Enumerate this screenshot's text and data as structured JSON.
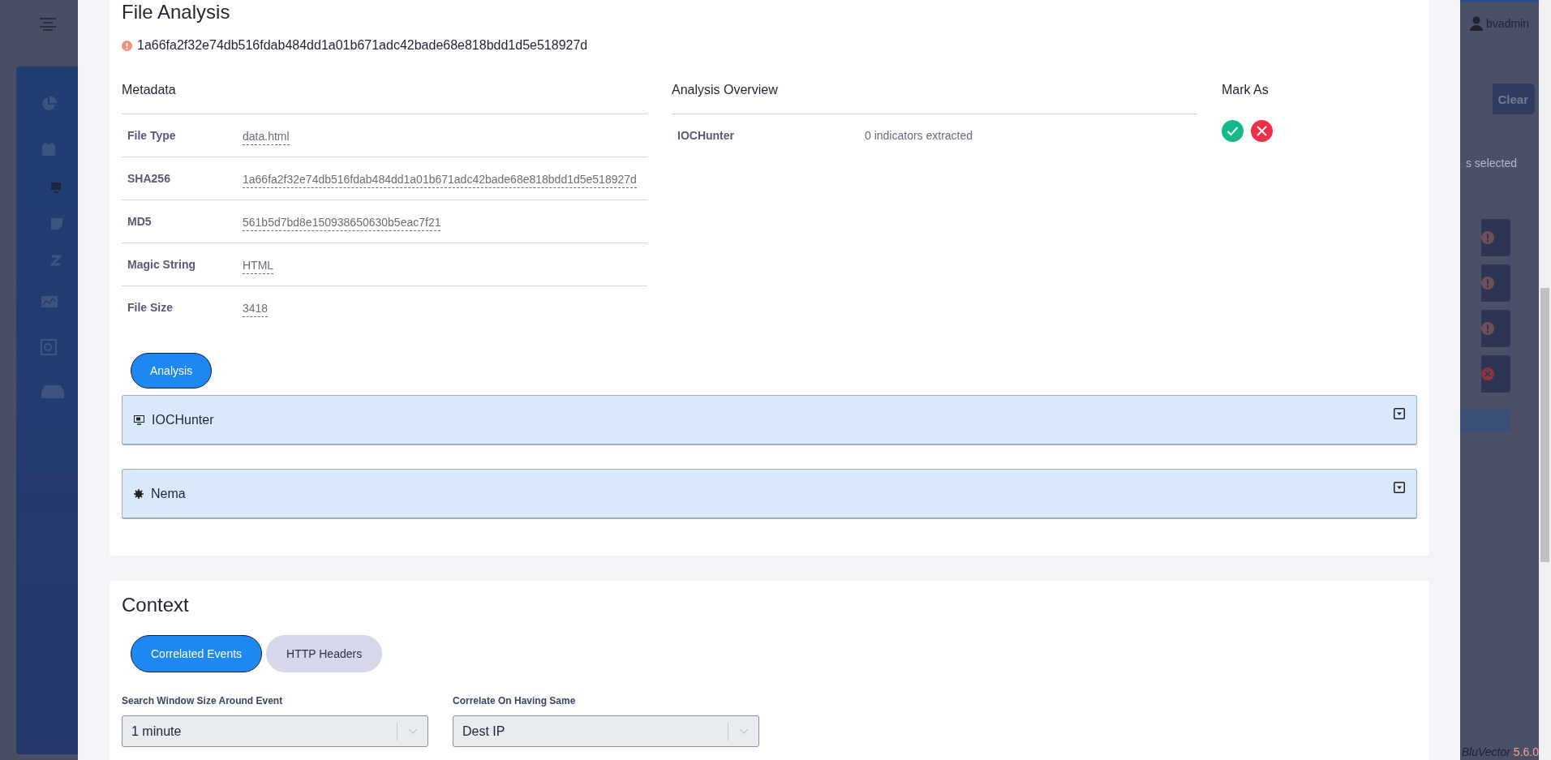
{
  "background": {
    "user": "bvadmin",
    "clear_button": "Clear",
    "selection_text": "s selected",
    "alerts": [
      {
        "kind": "warning"
      },
      {
        "kind": "warning"
      },
      {
        "kind": "warning"
      },
      {
        "kind": "error"
      }
    ],
    "footer": {
      "brand": "BluVector",
      "version": "5.6.0"
    }
  },
  "file_analysis": {
    "title": "File Analysis",
    "hash": "1a66fa2f32e74db516fdab484dd1a01b671adc42bade68e818bdd1d5e518927d",
    "metadata": {
      "heading": "Metadata",
      "rows": [
        {
          "label": "File Type",
          "value": "data.html"
        },
        {
          "label": "SHA256",
          "value": "1a66fa2f32e74db516fdab484dd1a01b671adc42bade68e818bdd1d5e518927d"
        },
        {
          "label": "MD5",
          "value": "561b5d7bd8e150938650630b5eac7f21"
        },
        {
          "label": "Magic String",
          "value": "HTML"
        },
        {
          "label": "File Size",
          "value": "3418"
        }
      ]
    },
    "overview": {
      "heading": "Analysis Overview",
      "rows": [
        {
          "label": "IOCHunter",
          "value": "0 indicators extracted"
        }
      ]
    },
    "mark_as": {
      "heading": "Mark As"
    },
    "tabs": [
      {
        "label": "Analysis",
        "selected": true
      }
    ],
    "panels": [
      {
        "title": "IOCHunter",
        "kind": "monitor"
      },
      {
        "title": "Nema",
        "kind": "gear"
      }
    ]
  },
  "context": {
    "title": "Context",
    "tabs": [
      {
        "label": "Correlated Events",
        "selected": true
      },
      {
        "label": "HTTP Headers",
        "selected": false
      }
    ],
    "fields": [
      {
        "label": "Search Window Size Around Event",
        "value": "1 minute"
      },
      {
        "label": "Correlate On Having Same",
        "value": "Dest IP"
      }
    ]
  }
}
